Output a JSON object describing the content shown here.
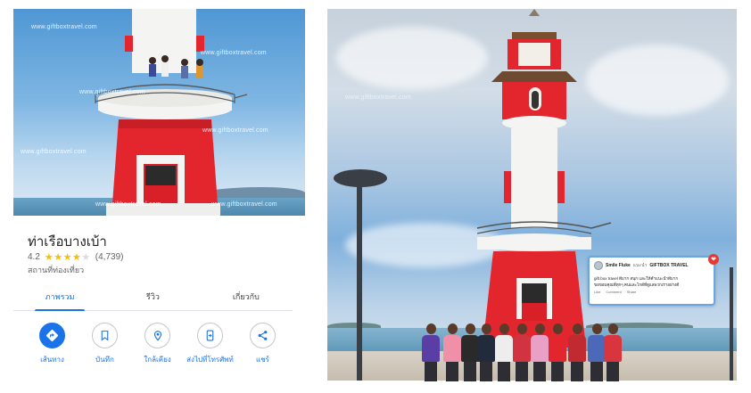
{
  "watermark": "www.giftboxtravel.com",
  "place": {
    "title": "ท่าเรือบางเบ้า",
    "rating": "4.2",
    "rating_value": 4.2,
    "review_count": "(4,739)",
    "category": "สถานที่ท่องเที่ยว"
  },
  "tabs": [
    {
      "label": "ภาพรวม",
      "active": true
    },
    {
      "label": "รีวิว",
      "active": false
    },
    {
      "label": "เกี่ยวกับ",
      "active": false
    }
  ],
  "actions": [
    {
      "label": "เส้นทาง",
      "icon": "directions-icon"
    },
    {
      "label": "บันทึก",
      "icon": "bookmark-icon"
    },
    {
      "label": "ใกล้เคียง",
      "icon": "nearby-icon"
    },
    {
      "label": "ส่งไปที่โทรศัพท์",
      "icon": "send-to-phone-icon"
    },
    {
      "label": "แชร์",
      "icon": "share-icon"
    }
  ],
  "social_card": {
    "name": "Smile Fluke",
    "sub": "แนะนำ",
    "page": "GIFTBOX TRAVEL",
    "text_line1": "gift box travel ดีมาก สนุก และให้คำแนะนำดีมาก",
    "text_line2": "ขอขอบคุณพี่ทุกๆ คนและไกด์ที่ดูแลพวกเราอย่างดี",
    "reaction_like": "Like",
    "reaction_comment": "Comment",
    "reaction_share": "Share"
  },
  "colors": {
    "accent_blue": "#1a73e8",
    "star_yellow": "#fbbc04",
    "lighthouse_red": "#e3262e"
  }
}
